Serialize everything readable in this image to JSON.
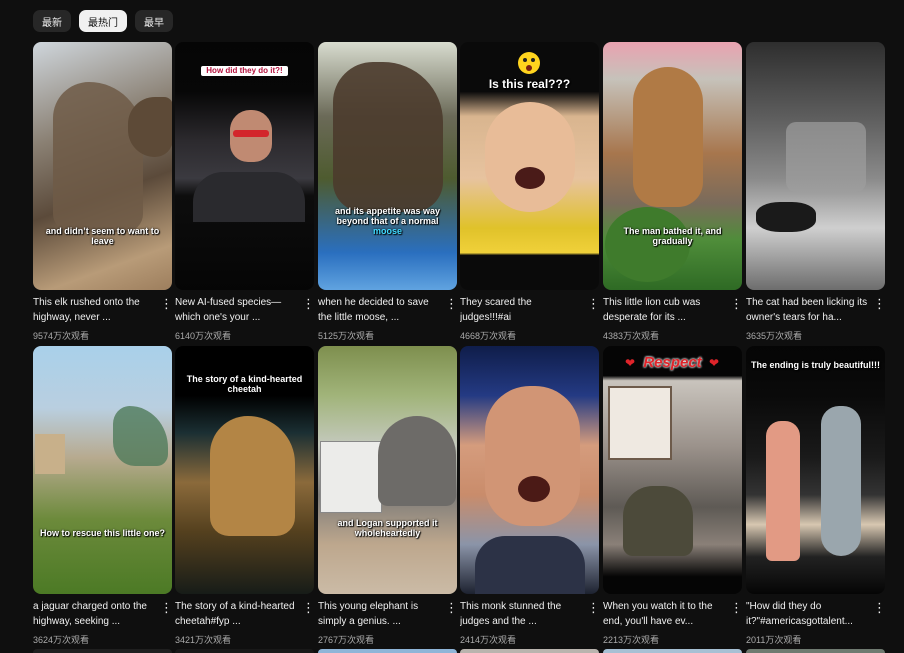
{
  "filters": [
    {
      "label": "最新",
      "active": false
    },
    {
      "label": "最热门",
      "active": true
    },
    {
      "label": "最早",
      "active": false
    }
  ],
  "videos": [
    {
      "title": "This elk rushed onto the highway, never ...",
      "views": "9574万次观看",
      "overlay": "and didn’t seem to want to leave"
    },
    {
      "title": "New AI-fused species—which one's your ...",
      "views": "6140万次观看",
      "overlay": "How did they do it?!"
    },
    {
      "title": "when he decided to save the little moose, ...",
      "views": "5125万次观看",
      "overlay": "and its appetite was way beyond that of a normal",
      "overlay_accent": "moose"
    },
    {
      "title": "They scared the judges!!!#ai",
      "views": "4668万次观看",
      "overlay": "Is this real???"
    },
    {
      "title": "This little lion cub was desperate for its ...",
      "views": "4383万次观看",
      "overlay": "The man bathed it, and gradually"
    },
    {
      "title": "The cat had been licking its owner's tears for ha...",
      "views": "3635万次观看",
      "overlay": ""
    },
    {
      "title": "a jaguar charged onto the highway, seeking ...",
      "views": "3624万次观看",
      "overlay": "How to rescue this little one?"
    },
    {
      "title": "The story of a kind-hearted cheetah#fyp ...",
      "views": "3421万次观看",
      "overlay": "The story of a kind-hearted cheetah"
    },
    {
      "title": "This young elephant is simply a genius. ...",
      "views": "2767万次观看",
      "overlay": "and Logan supported it wholeheartedly"
    },
    {
      "title": "This monk stunned the judges and the ...",
      "views": "2414万次观看",
      "overlay": ""
    },
    {
      "title": "When you watch it to the end, you'll have ev...",
      "views": "2213万次观看",
      "overlay": "Respect"
    },
    {
      "title": "\"How did they do it?\"#americasgottalent...",
      "views": "2011万次观看",
      "overlay": "The ending is truly beautiful!!!"
    }
  ],
  "colors": {
    "background": "#0f0f0f",
    "chip": "#272727",
    "chip_active": "#f1f1f1",
    "text_secondary": "#aaaaaa",
    "accent_cyan": "#3fd9ff",
    "respect_red": "#e0242a"
  },
  "icons": {
    "more": "more-vert-icon",
    "emoji": "surprised-emoji-icon",
    "heart": "heart-icon"
  }
}
